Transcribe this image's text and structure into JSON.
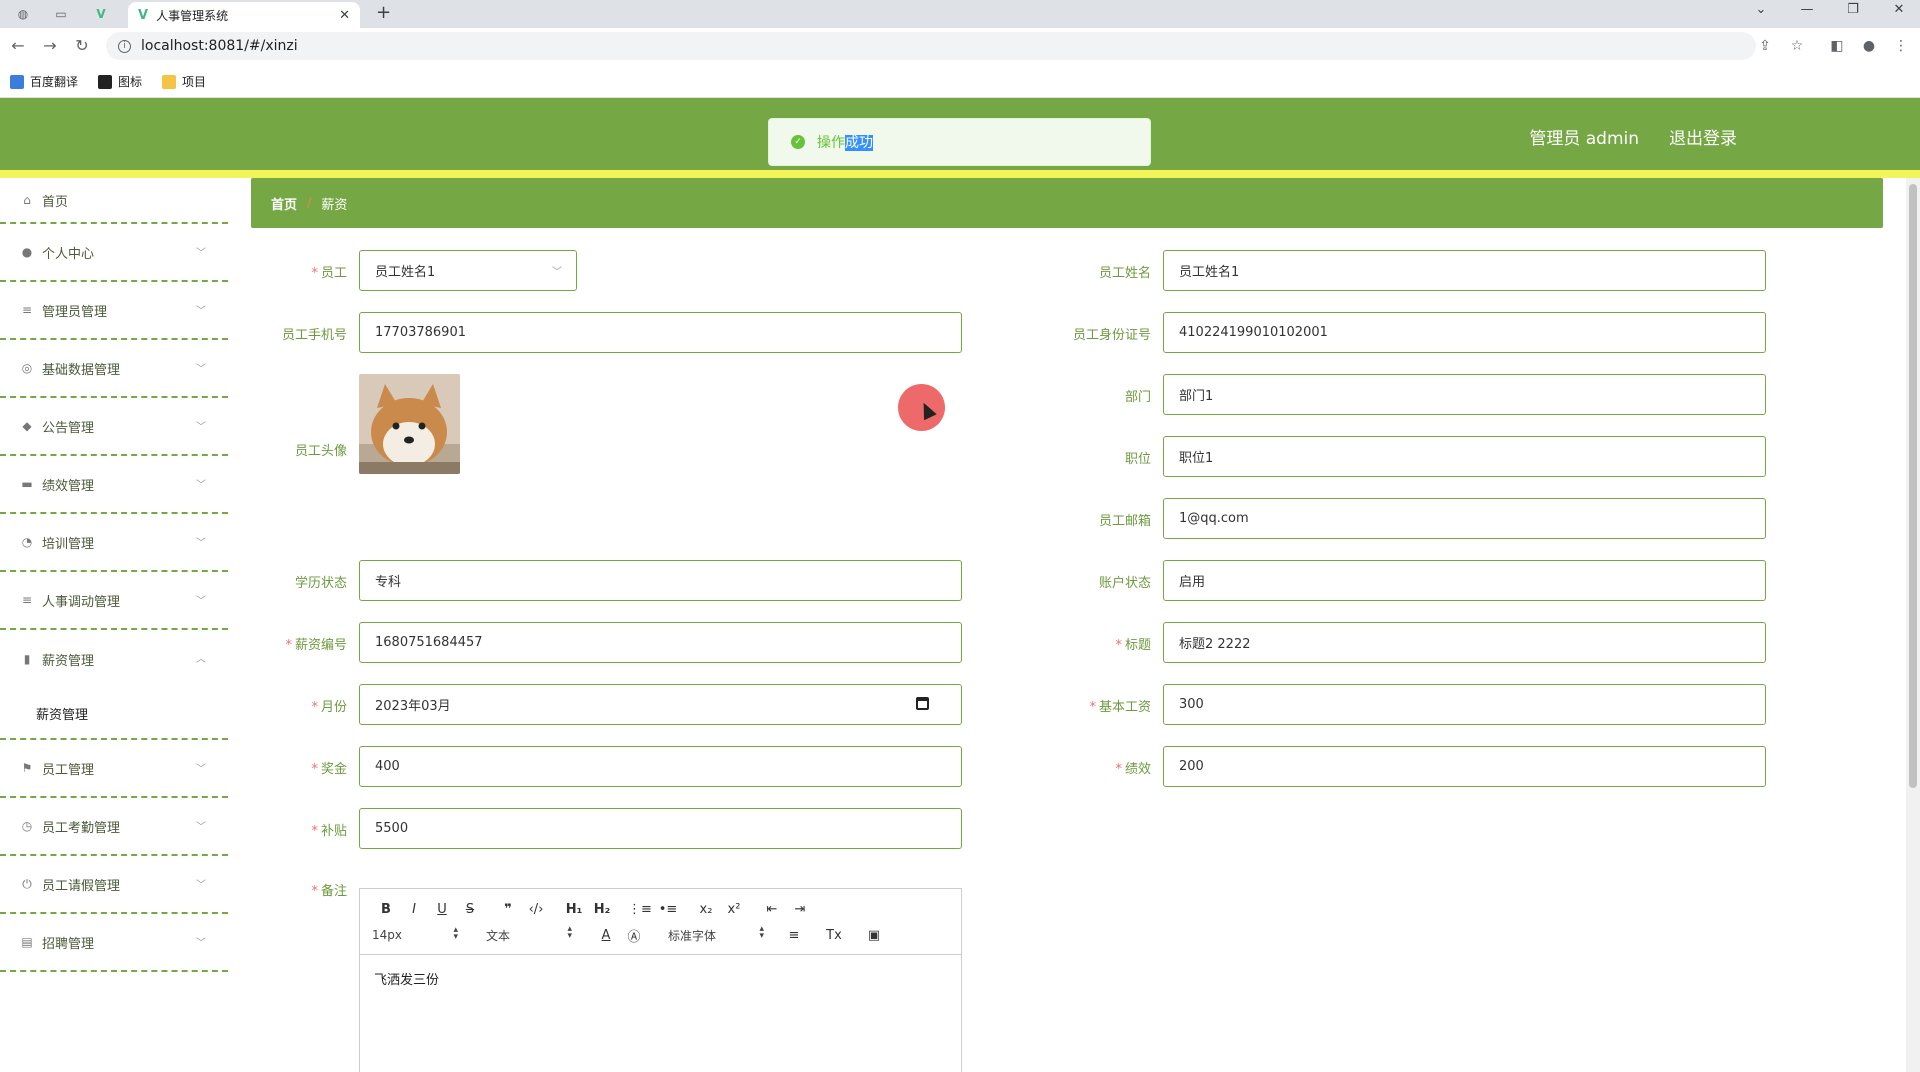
{
  "browser": {
    "tab_title": "人事管理系统",
    "url": "localhost:8081/#/xinzi",
    "bookmarks": [
      "百度翻译",
      "图标",
      "项目"
    ]
  },
  "header": {
    "user_label": "管理员 admin",
    "logout_label": "退出登录"
  },
  "toast": {
    "message_a": "操作",
    "message_b": "成功",
    "type": "success"
  },
  "sidebar": {
    "items": [
      {
        "label": "首页",
        "icon": "home-icon"
      },
      {
        "label": "个人中心",
        "icon": "user-icon"
      },
      {
        "label": "管理员管理",
        "icon": "menu-icon"
      },
      {
        "label": "基础数据管理",
        "icon": "settings-icon"
      },
      {
        "label": "公告管理",
        "icon": "pin-icon"
      },
      {
        "label": "绩效管理",
        "icon": "chat-icon"
      },
      {
        "label": "培训管理",
        "icon": "compass-icon"
      },
      {
        "label": "人事调动管理",
        "icon": "menu-icon"
      },
      {
        "label": "薪资管理",
        "icon": "chart-icon"
      },
      {
        "label": "员工管理",
        "icon": "flag-icon"
      },
      {
        "label": "员工考勤管理",
        "icon": "clock-icon"
      },
      {
        "label": "员工请假管理",
        "icon": "power-icon"
      },
      {
        "label": "招聘管理",
        "icon": "card-icon"
      }
    ],
    "open_submenu": {
      "label": "薪资管理"
    }
  },
  "breadcrumb": {
    "home": "首页",
    "separator": "/",
    "current": "薪资"
  },
  "form": {
    "employee": {
      "label": "员工",
      "value": "员工姓名1"
    },
    "employee_name": {
      "label": "员工姓名",
      "value": "员工姓名1"
    },
    "phone": {
      "label": "员工手机号",
      "value": "17703786901"
    },
    "id_card": {
      "label": "员工身份证号",
      "value": "410224199010102001"
    },
    "avatar": {
      "label": "员工头像"
    },
    "department": {
      "label": "部门",
      "value": "部门1"
    },
    "position": {
      "label": "职位",
      "value": "职位1"
    },
    "email": {
      "label": "员工邮箱",
      "value": "1@qq.com"
    },
    "education": {
      "label": "学历状态",
      "value": "专科"
    },
    "account_status": {
      "label": "账户状态",
      "value": "启用"
    },
    "salary_no": {
      "label": "薪资编号",
      "value": "1680751684457"
    },
    "title": {
      "label": "标题",
      "value": "标题2 2222"
    },
    "month": {
      "label": "月份",
      "value": "2023年03月"
    },
    "base_salary": {
      "label": "基本工资",
      "value": "300"
    },
    "bonus": {
      "label": "奖金",
      "value": "400"
    },
    "performance": {
      "label": "绩效",
      "value": "200"
    },
    "subsidy": {
      "label": "补贴",
      "value": "5500"
    },
    "remark": {
      "label": "备注",
      "content": "飞洒发三份"
    }
  },
  "editor": {
    "font_size": "14px",
    "header_select": "文本",
    "font_family": "标准字体"
  }
}
